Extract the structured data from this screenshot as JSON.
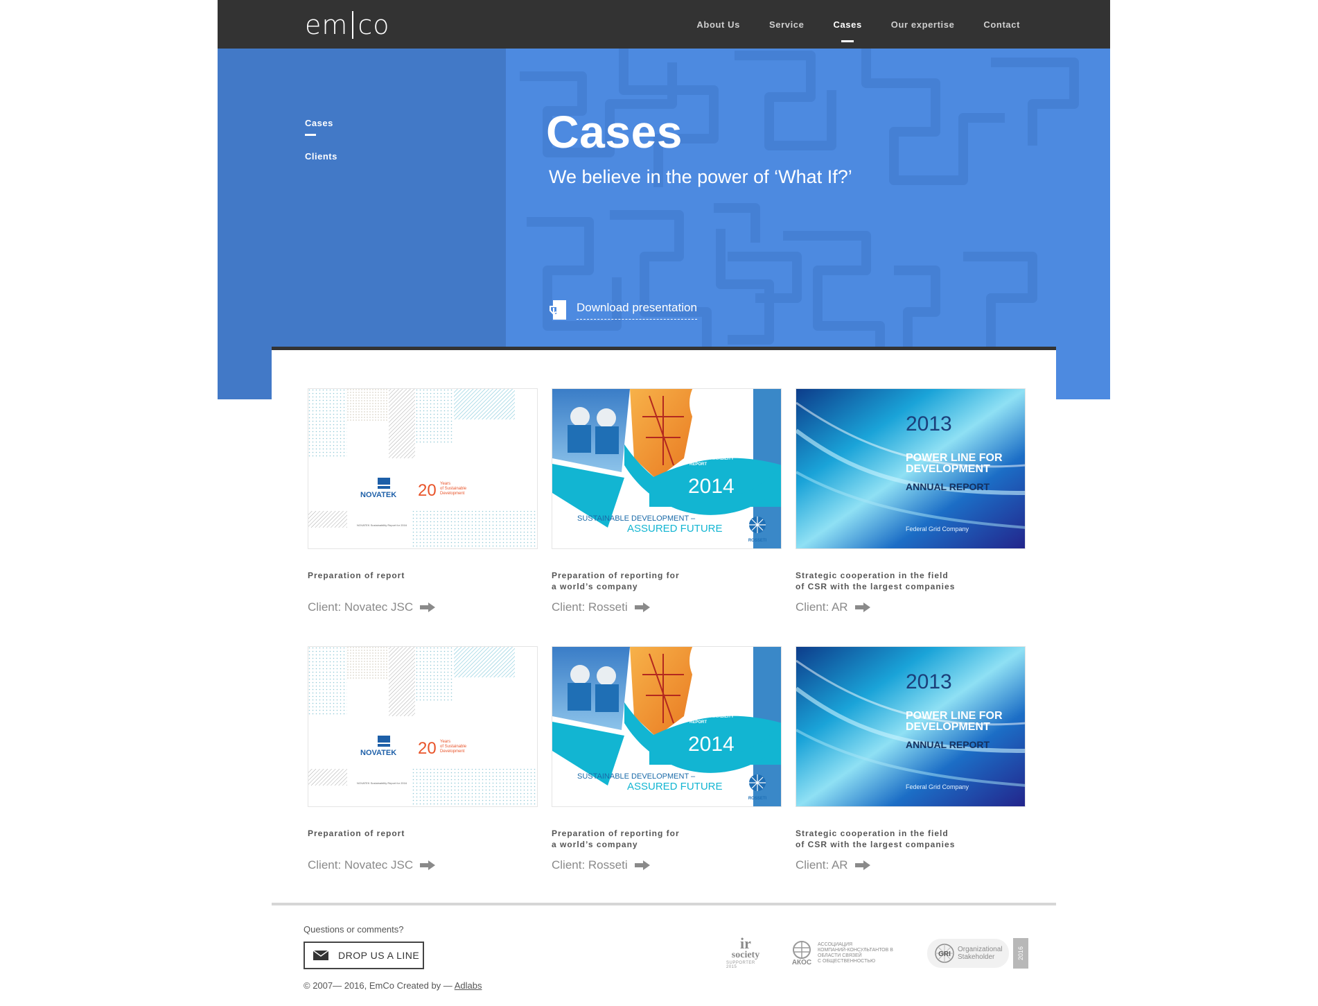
{
  "header": {
    "logo_left": "em",
    "logo_right": "co",
    "nav": [
      {
        "label": "About Us"
      },
      {
        "label": "Service"
      },
      {
        "label": "Cases"
      },
      {
        "label": "Our expertise"
      },
      {
        "label": "Contact"
      }
    ],
    "active_index": 2
  },
  "sidebar": {
    "items": [
      {
        "label": "Cases"
      },
      {
        "label": "Clients"
      }
    ]
  },
  "hero": {
    "title": "Cases",
    "subtitle": "We believe in the power of ‘What If?’",
    "download_label": "Download presentation"
  },
  "cards": [
    {
      "thumb": "novatek",
      "desc": "Preparation of report",
      "client": "Client: Novatec JSC",
      "thumb_text": {
        "brand": "NOVATEK",
        "number": "20",
        "caption": "Years\nof Sustainable\nDevelopment",
        "footer": "NOVATEK Sustainability Report for 2016"
      }
    },
    {
      "thumb": "rosseti",
      "desc": "Preparation of reporting for\na world’s company",
      "client": "Client: Rosseti",
      "thumb_text": {
        "report": "CORPORATE SOCIAL\nRESPONSIBILITY\nAND SUSTAINABILITY\nREPORT",
        "year": "2014",
        "line1": "SUSTAINABLE DEVELOPMENT –",
        "line2": "ASSURED FUTURE",
        "brand": "ROSSETI"
      }
    },
    {
      "thumb": "powerline",
      "desc": "Strategic cooperation in the field\nof CSR with the largest companies",
      "client": "Client: AR",
      "thumb_text": {
        "year": "2013",
        "title": "POWER LINE FOR\nDEVELOPMENT",
        "sub": "ANNUAL REPORT",
        "company": "Federal Grid Company"
      }
    },
    {
      "thumb": "novatek",
      "desc": "Preparation of report",
      "client": "Client: Novatec JSC",
      "thumb_text": {
        "brand": "NOVATEK",
        "number": "20",
        "caption": "Years\nof Sustainable\nDevelopment",
        "footer": "NOVATEK Sustainability Report for 2016"
      }
    },
    {
      "thumb": "rosseti",
      "desc": "Preparation of reporting for\na world’s company",
      "client": "Client: Rosseti",
      "thumb_text": {
        "report": "CORPORATE SOCIAL\nRESPONSIBILITY\nAND SUSTAINABILITY\nREPORT",
        "year": "2014",
        "line1": "SUSTAINABLE DEVELOPMENT –",
        "line2": "ASSURED FUTURE",
        "brand": "ROSSETI"
      }
    },
    {
      "thumb": "powerline",
      "desc": "Strategic cooperation in the field\nof CSR with the largest companies",
      "client": "Client: AR",
      "thumb_text": {
        "year": "2013",
        "title": "POWER LINE FOR\nDEVELOPMENT",
        "sub": "ANNUAL REPORT",
        "company": "Federal Grid Company"
      }
    }
  ],
  "footer": {
    "question": "Questions or comments?",
    "button": "DROP US A LINE",
    "copyright": "© 2007— 2016, EmCo   Created by —",
    "creator": "Adlabs",
    "partners": {
      "ir": "society",
      "ir_sub": "SUPPORTER 2015",
      "akos": "АКОС",
      "akos_desc": "АССОЦИАЦИЯ\nКОМПАНИЙ-КОНСУЛЬТАНТОВ В\nОБЛАСТИ СВЯЗЕЙ\nС ОБЩЕСТВЕННОСТЬЮ",
      "gri": "GRI",
      "gri_desc": "Organizational\nStakeholder",
      "gri_year": "2016"
    }
  },
  "colors": {
    "topbar": "#333333",
    "hero_left": "#4279c7",
    "hero_right": "#4d8ae0",
    "accent_cyan": "#12b5d2",
    "novatek_orange": "#e8542a"
  }
}
